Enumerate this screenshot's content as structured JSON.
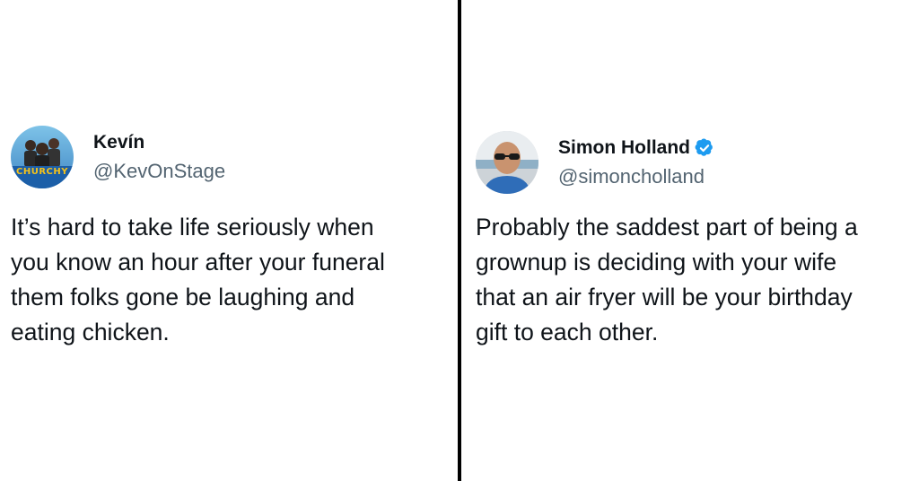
{
  "left_tweet": {
    "display_name": "Kevín",
    "handle": "@KevOnStage",
    "avatar_label": "CHURCHY",
    "text": "It’s hard to take life seriously when\nyou know an hour after your funeral\nthem folks gone be laughing and\neating chicken."
  },
  "right_tweet": {
    "display_name": "Simon Holland",
    "verified": true,
    "verified_icon": "verified-badge-icon",
    "handle": "@simoncholland",
    "text": "Probably the saddest part of being a\ngrownup is deciding with your wife\nthat an air fryer will be your birthday\ngift to each other."
  },
  "colors": {
    "text": "#0f1419",
    "handle": "#536471",
    "verified": "#1d9bf0",
    "divider": "#000000"
  }
}
